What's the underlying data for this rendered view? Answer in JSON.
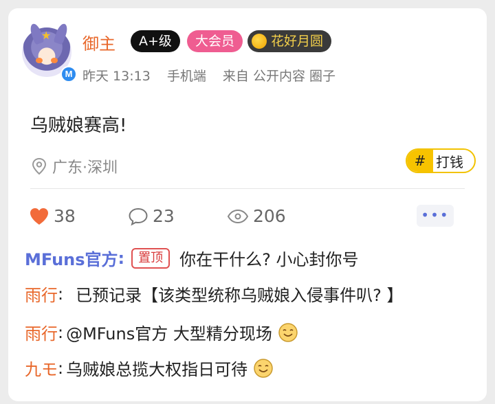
{
  "post": {
    "username": "御主",
    "level_badge": "A+级",
    "vip_badge": "大会员",
    "medal_badge": "花好月圆",
    "time": "昨天 13:13",
    "device": "手机端",
    "source": "来自 公开内容 圈子",
    "content": "乌贼娘赛高!",
    "location": "广东·深圳",
    "tag_hash": "#",
    "tag_text": "打钱"
  },
  "stats": {
    "likes": "38",
    "comments": "23",
    "views": "206",
    "more": "•••"
  },
  "comments": [
    {
      "author": "MFuns官方",
      "colon": ":",
      "pin": "置顶",
      "text": "你在干什么? 小心封你号"
    },
    {
      "author": "雨行",
      "colon": ":",
      "text": "已预记录【该类型统称乌贼娘入侵事件叭? 】"
    },
    {
      "author": "雨行",
      "colon": ":",
      "text": "@MFuns官方 大型精分现场",
      "emoji": "smile"
    },
    {
      "author": "九モ",
      "colon": ":",
      "text": "乌贼娘总揽大权指日可待",
      "emoji": "smile"
    }
  ],
  "colors": {
    "accent_orange": "#e8672a",
    "official_blue": "#5a6fd8",
    "heart": "#f26b3a",
    "tag_yellow": "#f7c300"
  },
  "icons": {
    "like": "heart-icon",
    "comment": "speech-bubble-icon",
    "view": "eye-icon",
    "location": "location-pin-icon"
  }
}
